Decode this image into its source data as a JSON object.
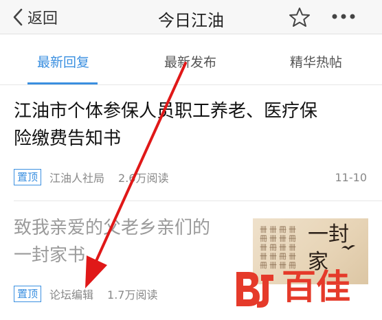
{
  "nav": {
    "back_label": "返回",
    "title": "今日江油",
    "icons": [
      "chevron-left-icon",
      "star-icon",
      "more-icon"
    ]
  },
  "tabs": [
    {
      "label": "最新回复",
      "active": true
    },
    {
      "label": "最新发布",
      "active": false
    },
    {
      "label": "精华热帖",
      "active": false
    }
  ],
  "posts": [
    {
      "title_line1": "江油市个体参保人员职工养老、医疗保",
      "title_line2": "险缴费告知书",
      "pin": "置顶",
      "source": "江油人社局",
      "views": "2.6万阅读",
      "date": "11-10"
    },
    {
      "title_line1": "致我亲爱的父老乡亲们的",
      "title_line2": "一封家书",
      "pin": "置顶",
      "source": "论坛编辑",
      "views": "1.7万阅读",
      "thumb_chars": "一封家"
    }
  ],
  "watermark": {
    "text": "百佳",
    "logo_mark": "BJ"
  },
  "colors": {
    "accent": "#3a8fe0",
    "arrow": "#e01818",
    "watermark": "#e53a2a"
  }
}
